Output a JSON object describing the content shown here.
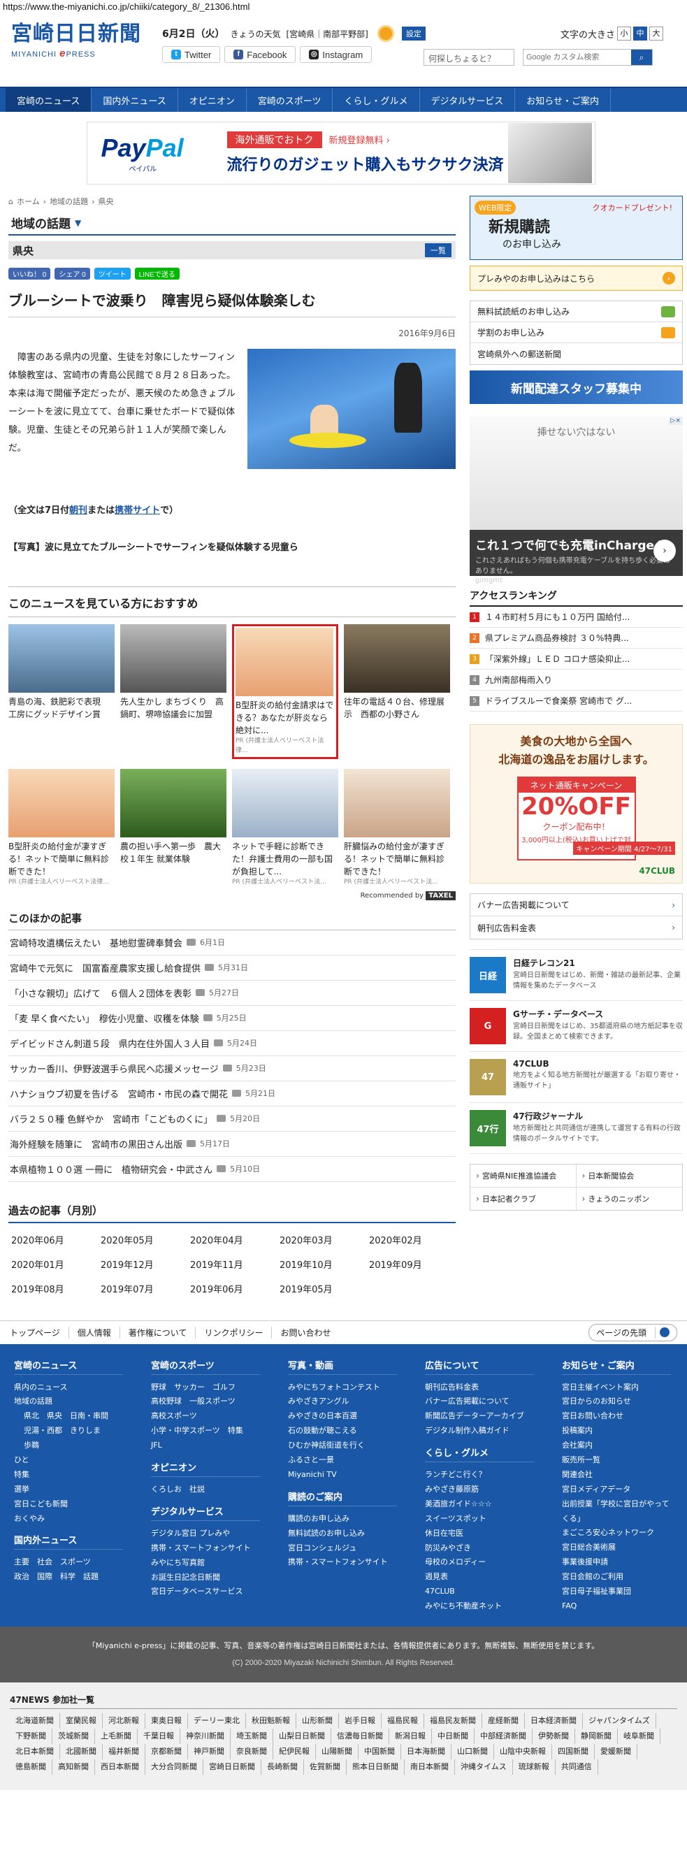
{
  "url": "https://www.the-miyanichi.co.jp/chiiki/category_8/_21306.html",
  "header": {
    "logo": "宮崎日日新聞",
    "logo_sub_prefix": "MIYANICHI",
    "logo_sub_brand": "e",
    "logo_sub_suffix": "PRESS",
    "date": "6月2日（火）",
    "weather_label": "きょうの天気",
    "weather_region": "[宮崎県｜南部平野部]",
    "setting_label": "設定",
    "twitter": "Twitter",
    "facebook": "Facebook",
    "instagram": "Instagram",
    "fontsize_label": "文字の大きさ",
    "fontsize_small": "小",
    "fontsize_mid": "中",
    "fontsize_large": "大",
    "question_placeholder": "何探しちょると？",
    "search_placeholder": "Google カスタム検索"
  },
  "nav": [
    "宮崎のニュース",
    "国内外ニュース",
    "オピニオン",
    "宮崎のスポーツ",
    "くらし・グルメ",
    "デジタルサービス",
    "お知らせ・ご案内"
  ],
  "banner": {
    "brand_pay": "Pay",
    "brand_pal": "Pal",
    "brand_kana": "ペイパル",
    "tag": "海外通販でおトク",
    "tag2": "新規登録無料 ›",
    "headline": "流行りのガジェット購入もサクサク決済"
  },
  "breadcrumb": [
    "ホーム",
    "地域の話題",
    "県央"
  ],
  "section_title": "地域の話題",
  "category": "県央",
  "category_button": "一覧",
  "share": {
    "like": "いいね！ 0",
    "fb": "シェア 0",
    "tweet": "ツイート",
    "line": "LINEで送る"
  },
  "article": {
    "title": "ブルーシートで波乗り　障害児ら疑似体験楽しむ",
    "date": "2016年9月6日",
    "body": "障害のある県内の児童、生徒を対象にしたサーフィン体験教室は、宮崎市の青島公民館で８月２８日あった。本来は海で開催予定だったが、悪天候のため急きょブルーシートを波に見立てて、台車に乗せたボードで疑似体験。児童、生徒とその兄弟ら計１１人が笑顔で楽しんだ。",
    "fulltext_pre": "（全文は7日付",
    "fulltext_link1": "朝刊",
    "fulltext_mid": "または",
    "fulltext_link2": "携帯サイト",
    "fulltext_post": "で）",
    "caption": "【写真】波に見立てたブルーシートでサーフィンを疑似体験する児童ら"
  },
  "recommend": {
    "title": "このニュースを見ている方におすすめ",
    "items": [
      {
        "text": "青島の海、鉄肥彩で表現　工房にグッドデザイン賞",
        "pr": ""
      },
      {
        "text": "先人生かし まちづくり　高鍋町、堺啼協議会に加盟",
        "pr": ""
      },
      {
        "text": "B型肝炎の給付金請求はできる？あなたが肝炎なら絶対に...",
        "pr": "PR (弁護士法人ベリーベスト法律..."
      },
      {
        "text": "往年の電話４０台、修理展示　西都の小野さん",
        "pr": ""
      },
      {
        "text": "B型肝炎の給付金が凄すぎる！ネットで簡単に無料診断できた！",
        "pr": "PR (弁護士法人ベリーベスト法律..."
      },
      {
        "text": "農の担い手へ第一歩　農大校１年生 就業体験",
        "pr": ""
      },
      {
        "text": "ネットで手軽に診断できた！弁護士費用の一部も国が負担して...",
        "pr": "PR (弁護士法人ベリーベスト法..."
      },
      {
        "text": "肝臓悩みの給付金が凄すぎる！ネットで簡単に無料診断できた！",
        "pr": "PR (弁護士法人ベリーベスト法..."
      }
    ],
    "recommended_by": "Recommended by",
    "taxel": "TAXEL"
  },
  "others": {
    "title": "このほかの記事",
    "items": [
      {
        "text": "宮崎特攻遺構伝えたい　基地慰霊碑奉賛会",
        "date": "6月1日"
      },
      {
        "text": "宮崎牛で元気に　国富畜産農家支援し給食提供",
        "date": "5月31日"
      },
      {
        "text": "「小さな親切」広げて　６個人２団体を表彰",
        "date": "5月27日"
      },
      {
        "text": "「麦 早く食べたい」　穆佐小児童、収穫を体験",
        "date": "5月25日"
      },
      {
        "text": "デイビッドさん刺道５段　県内在住外国人３人目",
        "date": "5月24日"
      },
      {
        "text": "サッカー香川、伊野波選手ら県民へ応援メッセージ",
        "date": "5月23日"
      },
      {
        "text": "ハナショウブ初夏を告げる　宮崎市・市民の森で開花",
        "date": "5月21日"
      },
      {
        "text": "バラ２５０種 色鮮やか　宮崎市「こどものくに」",
        "date": "5月20日"
      },
      {
        "text": "海外経験を随筆に　宮崎市の黒田さん出版",
        "date": "5月17日"
      },
      {
        "text": "本県植物１００選 一冊に　植物研究会・中武さん",
        "date": "5月10日"
      }
    ]
  },
  "past": {
    "title": "過去の記事（月別）",
    "months": [
      "2020年06月",
      "2020年05月",
      "2020年04月",
      "2020年03月",
      "2020年02月",
      "2020年01月",
      "2019年12月",
      "2019年11月",
      "2019年10月",
      "2019年09月",
      "2019年08月",
      "2019年07月",
      "2019年06月",
      "2019年05月"
    ]
  },
  "side": {
    "web_tag": "WEB限定",
    "quo": "クオカードプレゼント!",
    "new_sub": "新規購読",
    "apply": "のお申し込み",
    "premium": "プレみやのお申し込みはこちら",
    "box": [
      "無料試読紙のお申し込み",
      "学割のお申し込み",
      "宮崎県外への郵送新聞"
    ],
    "staff": "新聞配達スタッフ募集中",
    "ad2_top": "挿せない穴はない",
    "ad2_title": "これ１つで何でも充電inCharge６",
    "ad2_sub": "これさえあればもう何個も携帯充電ケーブルを持ち歩く必要はありません。",
    "ad2_brand": "gimgmt",
    "ranking_title": "アクセスランキング",
    "ranking": [
      {
        "no": "1",
        "text": "１４市町村５月にも１０万円 国給付..."
      },
      {
        "no": "2",
        "text": "県プレミアム商品券検討 ３０%特典..."
      },
      {
        "no": "3",
        "text": "「深紫外線」ＬＥＤ コロナ感染抑止..."
      },
      {
        "no": "4",
        "text": "九州南部梅雨入り"
      },
      {
        "no": "5",
        "text": "ドライブスルーで食楽祭 宮崎市で グ..."
      }
    ],
    "ad3_h1": "美食の大地から全国へ",
    "ad3_h2": "北海道の逸品をお届けします。",
    "ad3_camp": "ネット通販キャンペーン",
    "ad3_off": "20%OFF",
    "ad3_coupon": "クーポン配布中！",
    "ad3_note": "3,000円以上(税込)お買い上げで対象",
    "ad3_date": "キャンペーン期間 4/27〜7/31",
    "ad3_brand": "47CLUB",
    "links": [
      "バナー広告掲載について",
      "朝刊広告料金表"
    ],
    "services": [
      {
        "logo": "日経",
        "name": "日経テレコン21",
        "desc": "宮崎日日新聞をはじめ、新聞・雑誌の最新記事、企業情報を集めたデータベース"
      },
      {
        "logo": "G",
        "name": "Gサーチ・データベース",
        "desc": "宮崎日日新聞をはじめ、35都道府県の地方紙記事を収録。全国まとめて検索できます。"
      },
      {
        "logo": "47",
        "name": "47CLUB",
        "desc": "地方をよく知る地方新聞社が厳選する「お取り寄せ・通販サイト」"
      },
      {
        "logo": "47行",
        "name": "47行政ジャーナル",
        "desc": "地方新聞社と共同通信が連携して運営する有料の行政情報のポータルサイトです。"
      }
    ],
    "orgs": [
      "宮崎県NIE推進協議会",
      "日本新聞協会",
      "日本記者クラブ",
      "きょうのニッポン"
    ]
  },
  "footer_links": [
    "トップページ",
    "個人情報",
    "著作権について",
    "リンクポリシー",
    "お問い合わせ"
  ],
  "pagetop": "ページの先頭",
  "footer": {
    "c1": {
      "h": "宮崎のニュース",
      "items": [
        "県内のニュース",
        "地域の話題"
      ],
      "sub": [
        "県北　県央　日南・串間",
        "児湯・西都　きりしま",
        "歩鵜"
      ],
      "items2": [
        "ひと",
        "特集",
        "選挙",
        "宮日こども新聞",
        "おくやみ"
      ],
      "h2": "国内外ニュース",
      "items3": [
        "主要　社会　スポーツ",
        "政治　国際　科学　話題"
      ]
    },
    "c2": {
      "h": "宮崎のスポーツ",
      "items": [
        "野球　サッカー　ゴルフ",
        "高校野球　一般スポーツ",
        "高校スポーツ",
        "小学・中学スポーツ　特集",
        "JFL"
      ],
      "h2": "オピニオン",
      "items2": [
        "くろしお　社説"
      ],
      "h3": "デジタルサービス",
      "items3": [
        "デジタル宮日 プレみや",
        "携帯・スマートフォンサイト",
        "みやにち写真館",
        "お誕生日記念日新聞",
        "宮日データベースサービス"
      ]
    },
    "c3": {
      "h": "写真・動画",
      "items": [
        "みやにちフォトコンテスト",
        "みやざきアングル",
        "みやざきの日本百選",
        "石の鼓動が聴こえる",
        "ひむか神話街道を行く",
        "ふるさと一景",
        "Miyanichi TV"
      ],
      "h2": "購読のご案内",
      "items2": [
        "購読のお申し込み",
        "無料試読のお申し込み",
        "宮日コンシェルジュ",
        "携帯・スマートフォンサイト"
      ]
    },
    "c4": {
      "h": "広告について",
      "items": [
        "朝刊広告料金表",
        "バナー広告掲載について",
        "新聞広告データーアーカイブ",
        "デジタル制作入稿ガイド"
      ],
      "h2": "くらし・グルメ",
      "items2": [
        "ランチどこ行く？",
        "みやざき藤原筋",
        "美酒旅ガイド☆☆☆",
        "スイーツスポット",
        "休日在宅医",
        "防災みやざき",
        "母校のメロディー",
        "週見表",
        "47CLUB",
        "みやにち不動産ネット"
      ]
    },
    "c5": {
      "h": "お知らせ・ご案内",
      "items": [
        "宮日主催イベント案内",
        "宮日からのお知らせ",
        "宮日お問い合わせ",
        "投稿案内",
        "会社案内",
        "販売所一覧",
        "関連会社",
        "宮日メディアデータ",
        "出前授業「学校に宮日がやってくる」",
        "まごころ安心ネットワーク",
        "宮日総合美術展",
        "事業後援申請",
        "宮日会館のご利用",
        "宮日母子福祉事業団",
        "FAQ"
      ]
    }
  },
  "copyright": "「Miyanichi e-press」に掲載の記事、写真、音楽等の著作権は宮崎日日新聞社または、各情報提供者にあります。無断複製、無断使用を禁じます。",
  "copyright2": "(C) 2000-2020 Miyazaki Nichinichi Shimbun. All Rights Reserved.",
  "news47": {
    "title": "47NEWS 参加社一覧",
    "papers": [
      "北海道新聞",
      "室蘭民報",
      "河北新報",
      "東奥日報",
      "デーリー東北",
      "秋田魁新報",
      "山形新聞",
      "岩手日報",
      "福島民報",
      "福島民友新聞",
      "産経新聞",
      "日本経済新聞",
      "ジャパンタイムズ",
      "下野新聞",
      "茨城新聞",
      "上毛新聞",
      "千葉日報",
      "神奈川新聞",
      "埼玉新聞",
      "山梨日日新聞",
      "信濃毎日新聞",
      "新潟日報",
      "中日新聞",
      "中部経済新聞",
      "伊勢新聞",
      "静岡新聞",
      "岐阜新聞",
      "北日本新聞",
      "北國新聞",
      "福井新聞",
      "京都新聞",
      "神戸新聞",
      "奈良新聞",
      "紀伊民報",
      "山陽新聞",
      "中国新聞",
      "日本海新聞",
      "山口新聞",
      "山陰中央新報",
      "四国新聞",
      "愛媛新聞",
      "徳島新聞",
      "高知新聞",
      "西日本新聞",
      "大分合同新聞",
      "宮崎日日新聞",
      "長崎新聞",
      "佐賀新聞",
      "熊本日日新聞",
      "南日本新聞",
      "沖縄タイムス",
      "琉球新報",
      "共同通信"
    ]
  },
  "colors": {
    "brand": "#1a57a6",
    "accent": "#d8322b"
  }
}
